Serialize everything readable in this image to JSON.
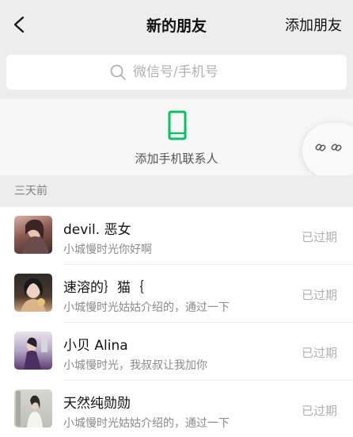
{
  "nav": {
    "title": "新的朋友",
    "action_label": "添加朋友"
  },
  "search": {
    "placeholder": "微信号/手机号"
  },
  "add_contacts": {
    "label": "添加手机联系人",
    "icon": "phone-icon",
    "icon_color": "#07c160"
  },
  "section": {
    "label": "三天前"
  },
  "friends": [
    {
      "name": "devil. 恶女",
      "message": "小城慢时光你好啊",
      "status": "已过期"
    },
    {
      "name": "速溶的｝猫｛",
      "message": "小城慢时光姑姑介绍的，通过一下",
      "status": "已过期"
    },
    {
      "name": "小贝 Alina",
      "message": "小城慢时光，我叔叔让我加你",
      "status": "已过期"
    },
    {
      "name": "天然纯勋勋",
      "message": "小城慢时光姑姑介绍的，通过一下",
      "status": "已过期"
    }
  ]
}
